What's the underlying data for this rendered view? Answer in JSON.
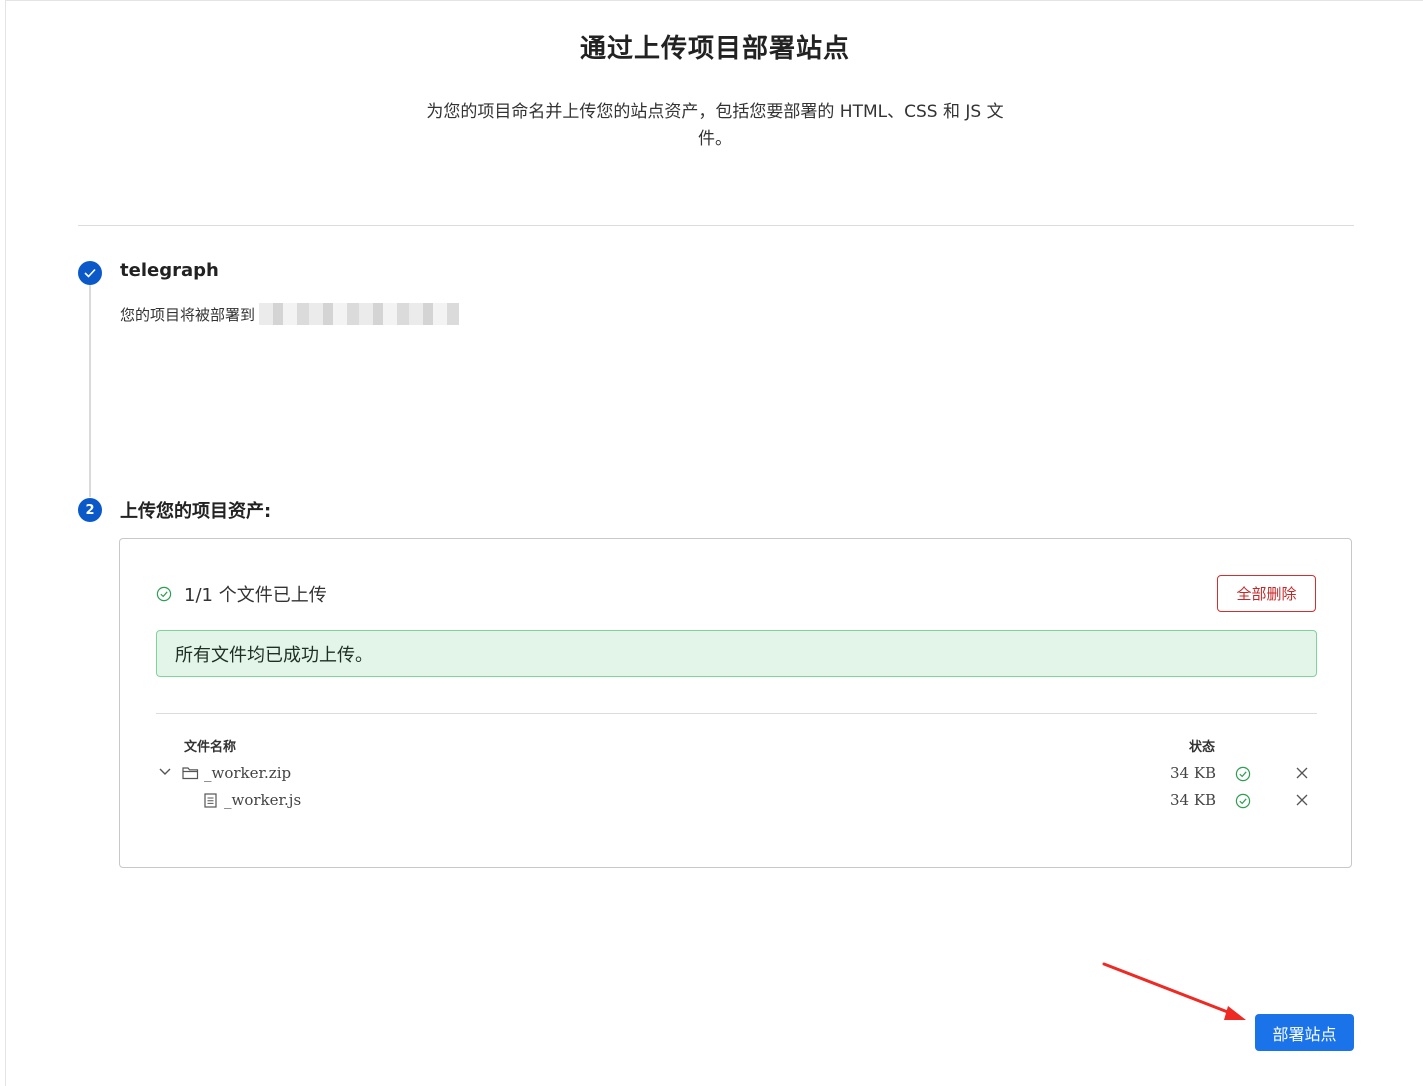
{
  "page": {
    "title": "通过上传项目部署站点",
    "description": "为您的项目命名并上传您的站点资产，包括您要部署的 HTML、CSS 和 JS 文件。"
  },
  "step1": {
    "title": "telegraph",
    "subtitle": "您的项目将被部署到"
  },
  "step2": {
    "number": "2",
    "title": "上传您的项目资产:",
    "upload_status": "1/1 个文件已上传",
    "delete_all_label": "全部删除",
    "success_message": "所有文件均已成功上传。",
    "table": {
      "col_name": "文件名称",
      "col_status": "状态",
      "files": [
        {
          "name": "_worker.zip",
          "size": "34 KB",
          "type": "folder",
          "status_icon": "check-circle-icon"
        },
        {
          "name": "_worker.js",
          "size": "34 KB",
          "type": "file",
          "status_icon": "check-circle-icon"
        }
      ]
    }
  },
  "actions": {
    "deploy_label": "部署站点"
  },
  "colors": {
    "primary": "#1a73e8",
    "step": "#0b59c9",
    "success_bg": "#e3f5e8",
    "success_border": "#7fd39a",
    "danger": "#c62828",
    "annotation_arrow": "#ee2a24"
  }
}
